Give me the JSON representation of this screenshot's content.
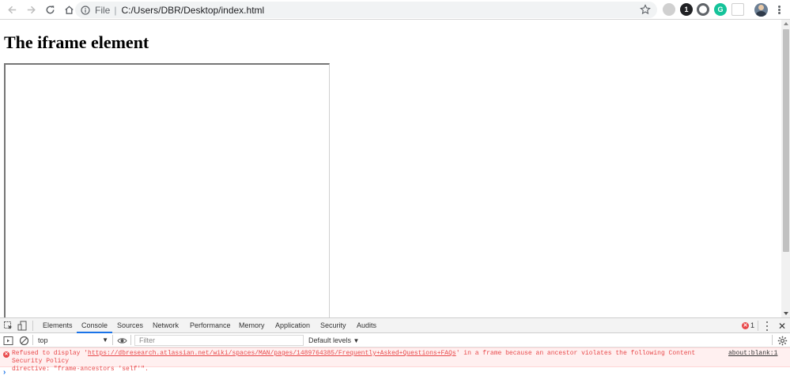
{
  "browser": {
    "scheme": "File",
    "separator": "|",
    "url": "C:/Users/DBR/Desktop/index.html",
    "extensions": [
      {
        "name": "extension-leaf-icon",
        "color": "#c9c9c9",
        "glyph": ""
      },
      {
        "name": "extension-one-icon",
        "color": "#202124",
        "glyph": "1"
      },
      {
        "name": "extension-circle-icon",
        "color": "#5f6368",
        "glyph": ""
      },
      {
        "name": "grammarly-icon",
        "color": "#15c39a",
        "glyph": "G"
      },
      {
        "name": "extension-box-icon",
        "color": "#e8e8e8",
        "glyph": ""
      }
    ]
  },
  "page": {
    "title": "The iframe element"
  },
  "devtools": {
    "tabs": [
      "Elements",
      "Console",
      "Sources",
      "Network",
      "Performance",
      "Memory",
      "Application",
      "Security",
      "Audits"
    ],
    "active_tab": "Console",
    "error_count": "1",
    "context": "top",
    "filter_placeholder": "Filter",
    "levels": "Default levels",
    "console": {
      "message_prefix": "Refused to display '",
      "message_link": "https://dbresearch.atlassian.net/wiki/spaces/MAN/pages/1489764385/Frequently+Asked+Questions+FAQs",
      "message_suffix": "' in a frame because an ancestor violates the following Content Security Policy\ndirective: \"frame-ancestors 'self'\".",
      "source": "about:blank:1",
      "prompt": "›"
    },
    "colors": {
      "error": "#e8484a",
      "active_tab_underline": "#1a73e8"
    }
  }
}
